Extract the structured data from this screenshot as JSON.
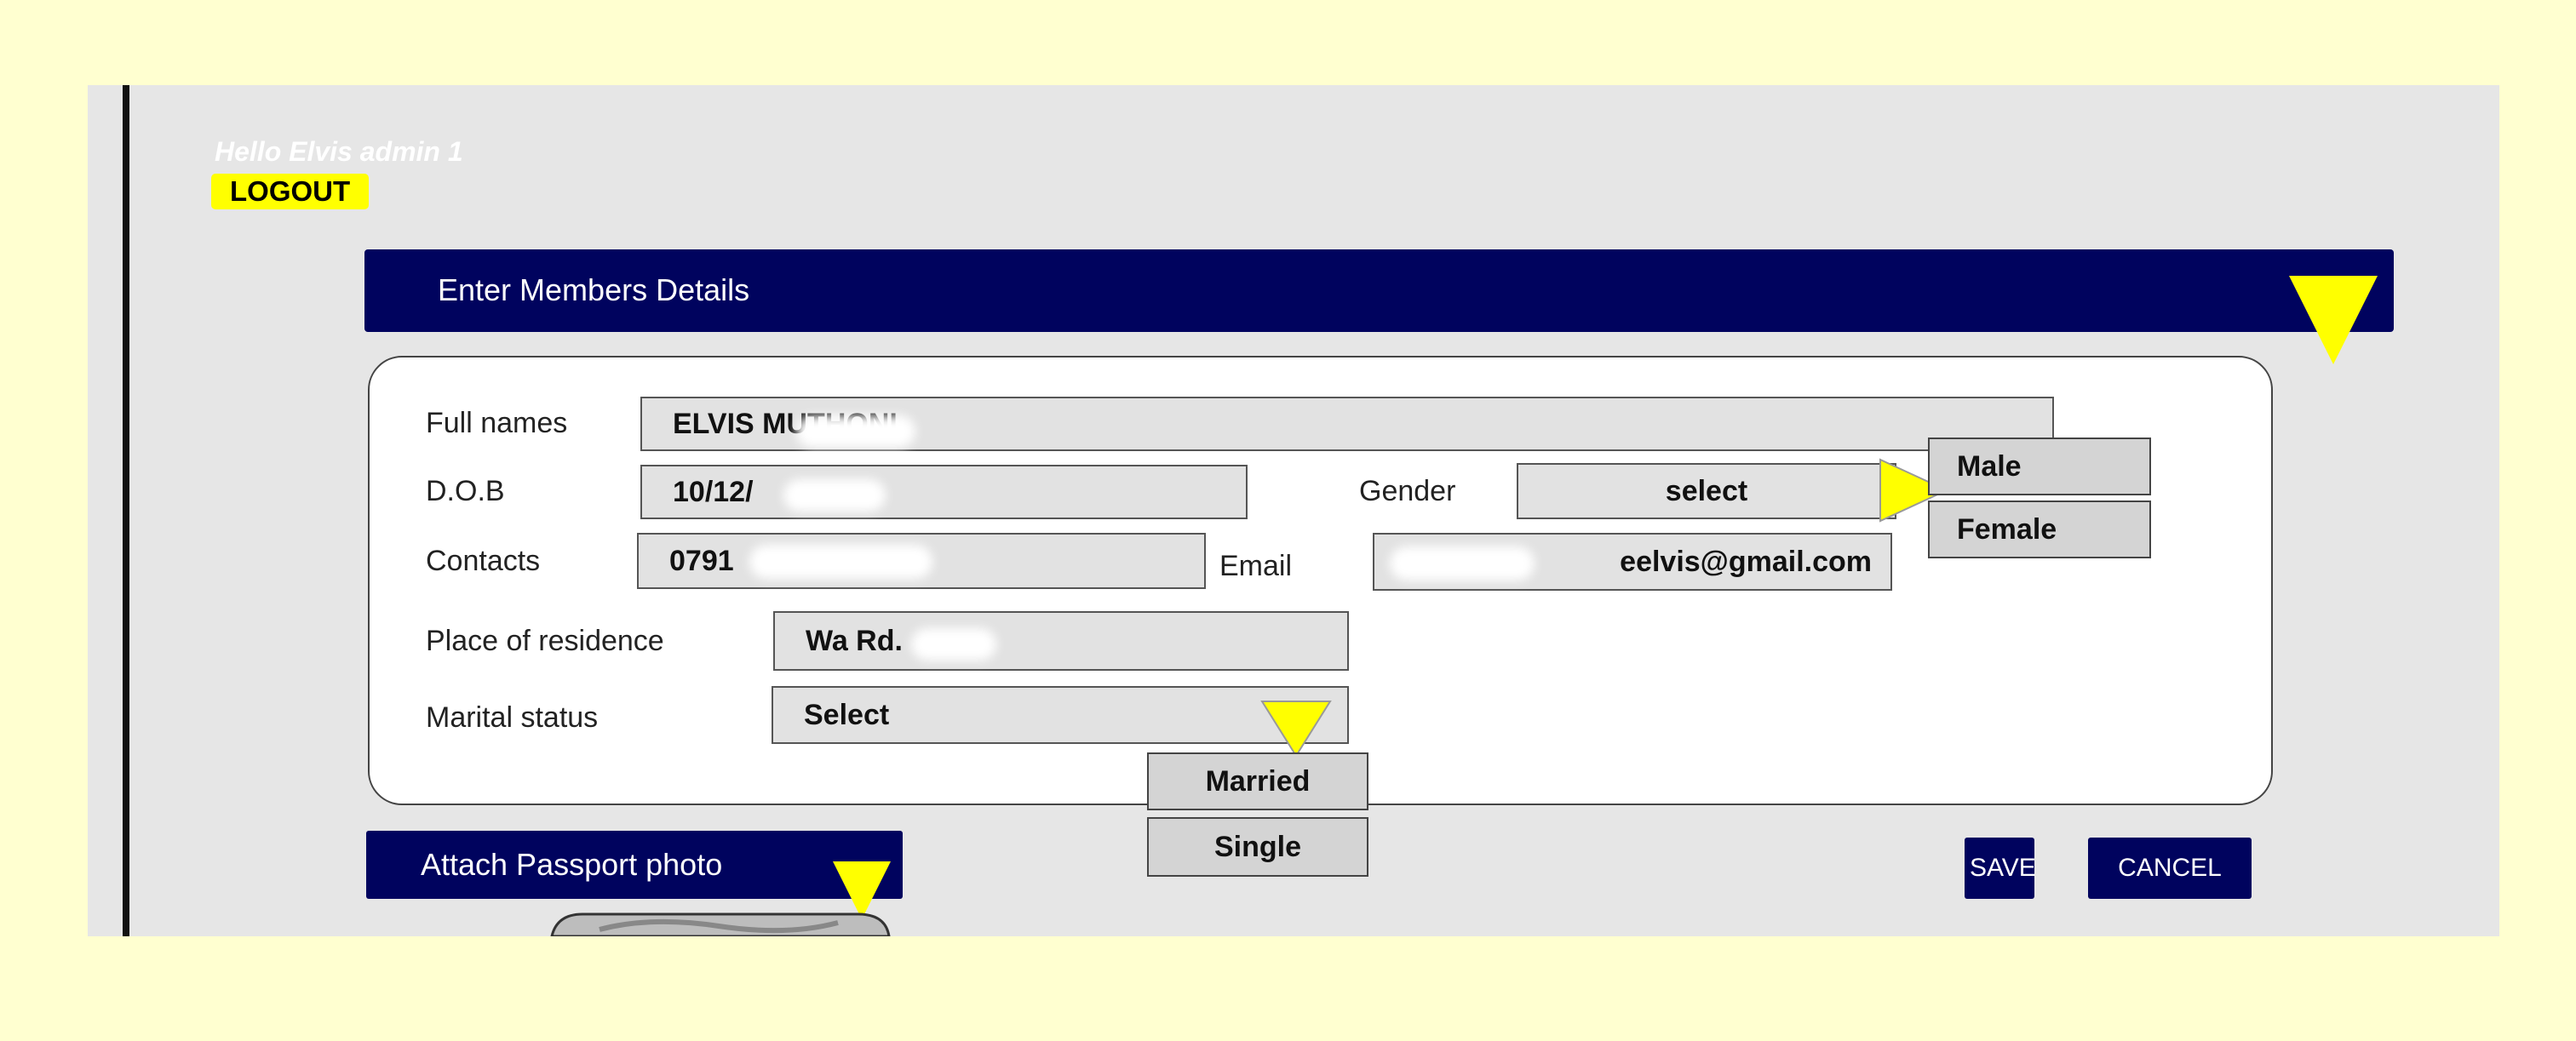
{
  "header": {
    "greeting": "Hello Elvis admin 1",
    "logout_label": "LOGOUT",
    "section_title": "Enter Members Details"
  },
  "form": {
    "full_names": {
      "label": "Full names",
      "value": "ELVIS MUTHONI"
    },
    "dob": {
      "label": "D.O.B",
      "value": "10/12/"
    },
    "gender": {
      "label": "Gender",
      "value": "select",
      "options": [
        "Male",
        "Female"
      ]
    },
    "contacts": {
      "label": "Contacts",
      "value": "0791"
    },
    "email": {
      "label": "Email",
      "value": "eelvis@gmail.com"
    },
    "residence": {
      "label": "Place of residence",
      "value": "Wa     Rd."
    },
    "marital_status": {
      "label": "Marital status",
      "value": "Select",
      "options": [
        "Married",
        "Single"
      ]
    }
  },
  "actions": {
    "attach_label": "Attach Passport photo",
    "save_label": "SAVE",
    "cancel_label": "CANCEL"
  },
  "colors": {
    "page_bg": "#ffffd0",
    "panel_bg": "#e6e6e6",
    "navy": "#00035e",
    "accent_yellow": "#ffff00"
  }
}
